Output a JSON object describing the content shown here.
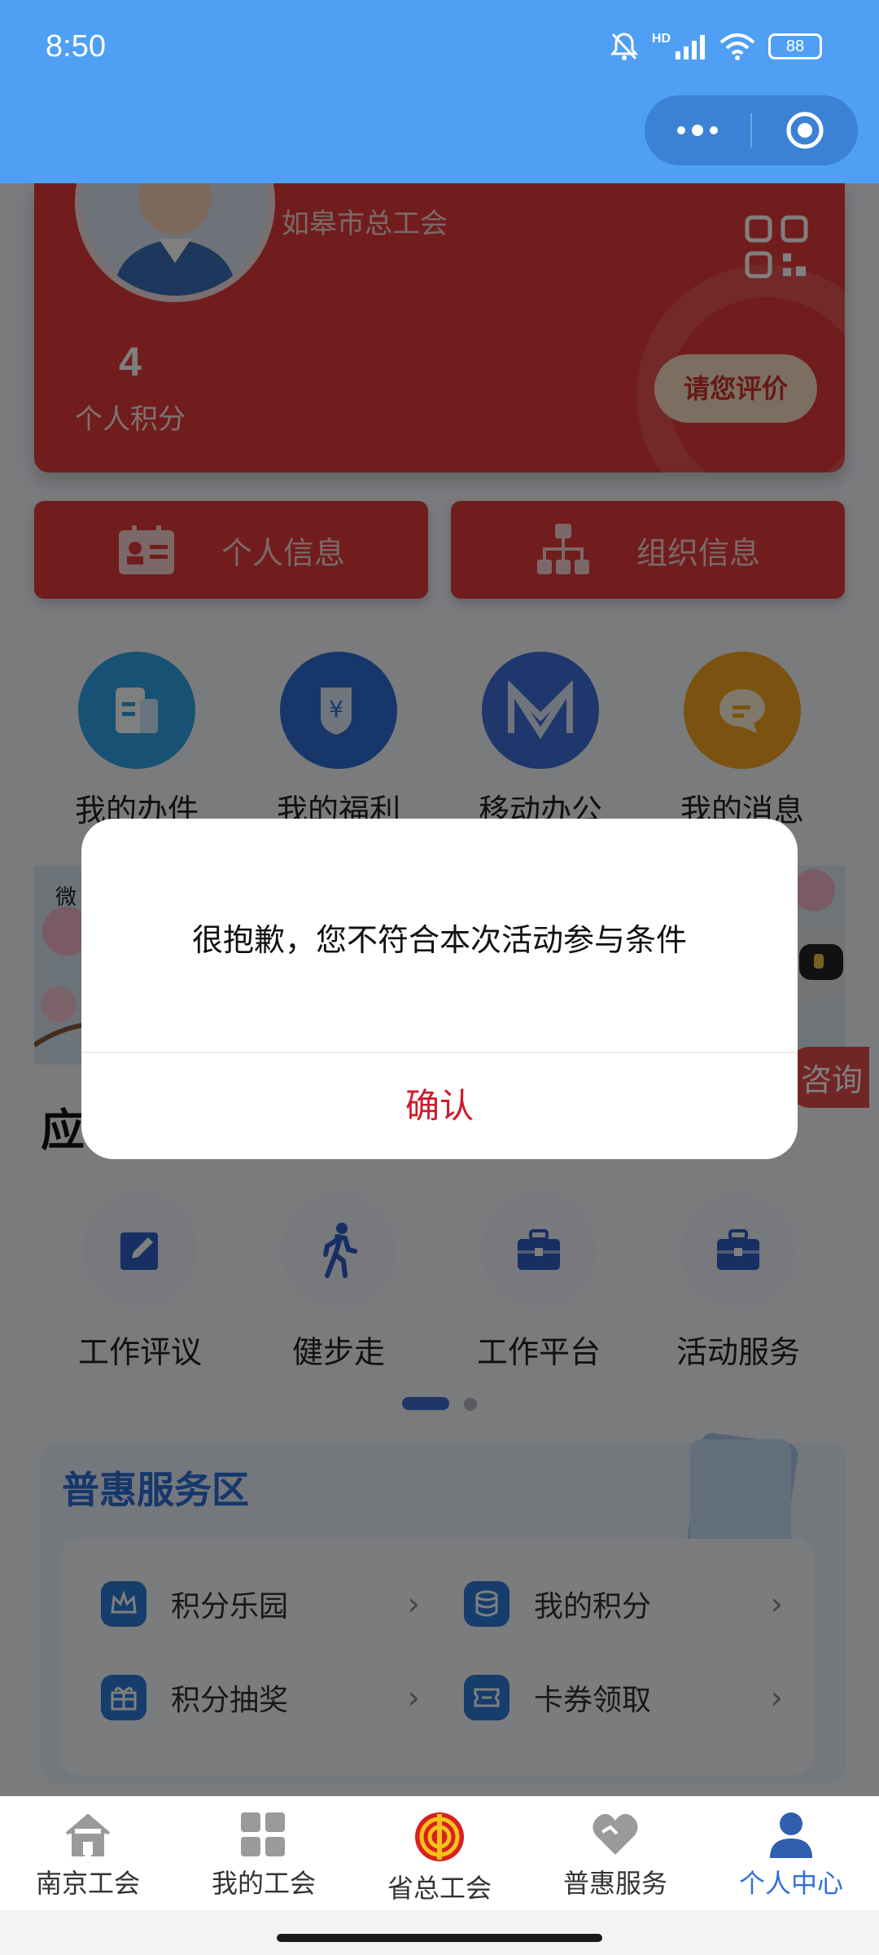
{
  "status_bar": {
    "time": "8:50",
    "battery": "88",
    "network": "HD"
  },
  "profile": {
    "org_name": "如皋市总工会",
    "points_value": "4",
    "points_label": "个人积分",
    "rate_button": "请您评价"
  },
  "info_buttons": {
    "personal": "个人信息",
    "organization": "组织信息"
  },
  "quick_actions": [
    {
      "label": "我的办件",
      "icon": "document-icon",
      "color": "#2fa3e6"
    },
    {
      "label": "我的福利",
      "icon": "yuan-shield-icon",
      "color": "#2f6fd6"
    },
    {
      "label": "移动办公",
      "icon": "m-logo-icon",
      "color": "#3f6fd8"
    },
    {
      "label": "我的消息",
      "icon": "chat-bubble-icon",
      "color": "#f6a41f"
    }
  ],
  "banner": {
    "left_text": "微",
    "consult_label": "咨询"
  },
  "apps_section": {
    "title": "应",
    "items": [
      {
        "label": "工作评议",
        "icon": "edit-icon"
      },
      {
        "label": "健步走",
        "icon": "walking-icon"
      },
      {
        "label": "工作平台",
        "icon": "briefcase-icon"
      },
      {
        "label": "活动服务",
        "icon": "toolbox-icon"
      }
    ]
  },
  "benefit_section": {
    "title": "普惠服务区",
    "items": [
      {
        "label": "积分乐园",
        "icon": "crown-icon"
      },
      {
        "label": "我的积分",
        "icon": "coins-icon"
      },
      {
        "label": "积分抽奖",
        "icon": "gift-icon"
      },
      {
        "label": "卡券领取",
        "icon": "ticket-icon"
      }
    ]
  },
  "dialog": {
    "message": "很抱歉，您不符合本次活动参与条件",
    "confirm": "确认"
  },
  "tab_bar": [
    {
      "label": "南京工会",
      "icon": "home-icon"
    },
    {
      "label": "我的工会",
      "icon": "grid-icon"
    },
    {
      "label": "省总工会",
      "icon": "union-emblem-icon"
    },
    {
      "label": "普惠服务",
      "icon": "heart-icon"
    },
    {
      "label": "个人中心",
      "icon": "user-icon",
      "active": true
    }
  ],
  "colors": {
    "brand_blue": "#4f9ff5",
    "union_red": "#e33b3b",
    "confirm_red": "#d01a2c",
    "tab_active": "#3171d6"
  }
}
